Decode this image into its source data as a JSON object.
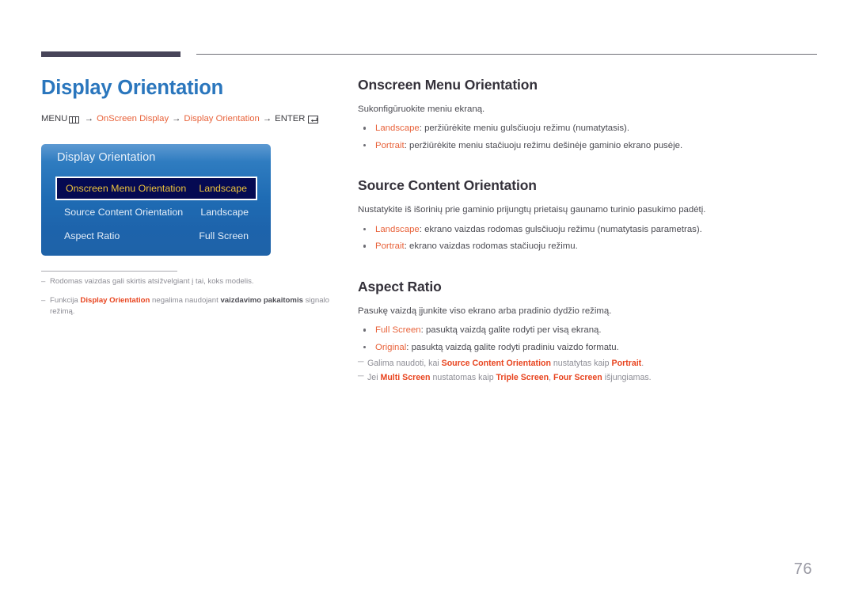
{
  "header": {
    "bar_color": "#474459",
    "line_color": "#6f6f76"
  },
  "left": {
    "page_title": "Display Orientation",
    "breadcrumb": {
      "menu_label": "MENU",
      "menu_icon": "menu-grid-icon",
      "arrow": "→",
      "step1": "OnScreen Display",
      "step2": "Display Orientation",
      "enter_label": "ENTER",
      "enter_icon": "enter-return-icon",
      "accent_color": "#e8623a"
    },
    "osd": {
      "title": "Display Orientation",
      "rows": [
        {
          "label": "Onscreen Menu Orientation",
          "value": "Landscape",
          "selected": true
        },
        {
          "label": "Source Content Orientation",
          "value": "Landscape",
          "selected": false
        },
        {
          "label": "Aspect Ratio",
          "value": "Full Screen",
          "selected": false
        }
      ],
      "selected_bg": "#050a52",
      "selected_text": "#ecc33b"
    },
    "notes": [
      {
        "dash": "–",
        "parts": [
          {
            "text": "Rodomas vaizdas gali skirtis atsižvelgiant į tai, koks modelis.",
            "style": "plain"
          }
        ]
      },
      {
        "dash": "–",
        "parts": [
          {
            "text": "Funkcija ",
            "style": "plain"
          },
          {
            "text": "Display Orientation",
            "style": "red"
          },
          {
            "text": " negalima naudojant ",
            "style": "plain"
          },
          {
            "text": "vaizdavimo pakaitomis",
            "style": "dark"
          },
          {
            "text": " signalo režimą.",
            "style": "plain"
          }
        ]
      }
    ]
  },
  "right": {
    "sections": [
      {
        "title": "Onscreen Menu Orientation",
        "intro": "Sukonfigūruokite meniu ekraną.",
        "bullets": [
          {
            "term": "Landscape",
            "rest": ": peržiūrėkite meniu gulsc̆iuoju režimu (numatytasis)."
          },
          {
            "term": "Portrait",
            "rest": ": peržiūrėkite meniu stac̆iuoju režimu dešinėje gaminio ekrano pusėje."
          }
        ],
        "subnotes": []
      },
      {
        "title": "Source Content Orientation",
        "intro": "Nustatykite iš išorinių prie gaminio prijungtų prietaisų gaunamo turinio pasukimo padėtį.",
        "bullets": [
          {
            "term": "Landscape",
            "rest": ": ekrano vaizdas rodomas gulsc̆iuoju režimu (numatytasis parametras)."
          },
          {
            "term": "Portrait",
            "rest": ": ekrano vaizdas rodomas stac̆iuoju režimu."
          }
        ],
        "subnotes": []
      },
      {
        "title": "Aspect Ratio",
        "intro": "Pasukę vaizdą įjunkite viso ekrano arba pradinio dydžio režimą.",
        "bullets": [
          {
            "term": "Full Screen",
            "rest": ": pasuktą vaizdą galite rodyti per visą ekraną."
          },
          {
            "term": "Original",
            "rest": ": pasuktą vaizdą galite rodyti pradiniu vaizdo formatu."
          }
        ],
        "subnotes": [
          {
            "dash": "─",
            "parts": [
              {
                "text": "Galima naudoti, kai ",
                "style": "plain"
              },
              {
                "text": "Source Content Orientation",
                "style": "red"
              },
              {
                "text": " nustatytas kaip ",
                "style": "plain"
              },
              {
                "text": "Portrait",
                "style": "red"
              },
              {
                "text": ".",
                "style": "plain"
              }
            ]
          },
          {
            "dash": "─",
            "parts": [
              {
                "text": "Jei ",
                "style": "plain"
              },
              {
                "text": "Multi Screen",
                "style": "red"
              },
              {
                "text": " nustatomas kaip ",
                "style": "plain"
              },
              {
                "text": "Triple Screen",
                "style": "red"
              },
              {
                "text": ", ",
                "style": "plain"
              },
              {
                "text": "Four Screen",
                "style": "red"
              },
              {
                "text": " išjungiamas.",
                "style": "plain"
              }
            ]
          }
        ]
      }
    ]
  },
  "footer": {
    "page_number": "76"
  }
}
